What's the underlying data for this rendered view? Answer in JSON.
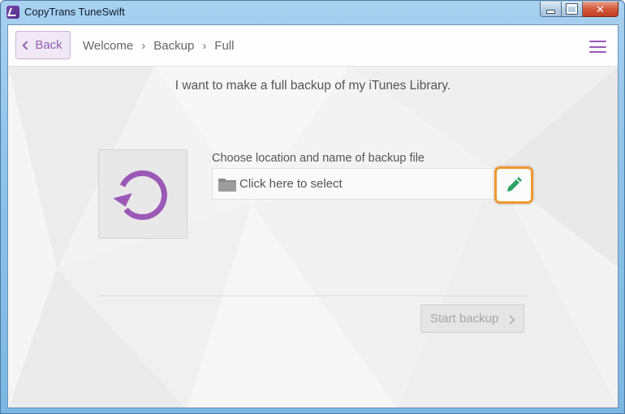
{
  "window": {
    "title": "CopyTrans TuneSwift"
  },
  "navbar": {
    "back_label": "Back",
    "breadcrumb": [
      "Welcome",
      "Backup",
      "Full"
    ],
    "separator": "›"
  },
  "main": {
    "headline": "I want to make a full backup of my iTunes Library.",
    "location_label": "Choose location and name of backup file",
    "select_placeholder": "Click here to select",
    "start_button_label": "Start backup"
  },
  "colors": {
    "accent_purple": "#9b59b6",
    "edit_icon_green": "#2ea566",
    "highlight_orange": "#f0972e"
  },
  "icons": [
    "app-logo-icon",
    "minimize-icon",
    "maximize-icon",
    "close-icon",
    "chevron-left-icon",
    "menu-icon",
    "restore-backup-icon",
    "folder-icon",
    "pencil-icon",
    "chevron-right-icon"
  ]
}
